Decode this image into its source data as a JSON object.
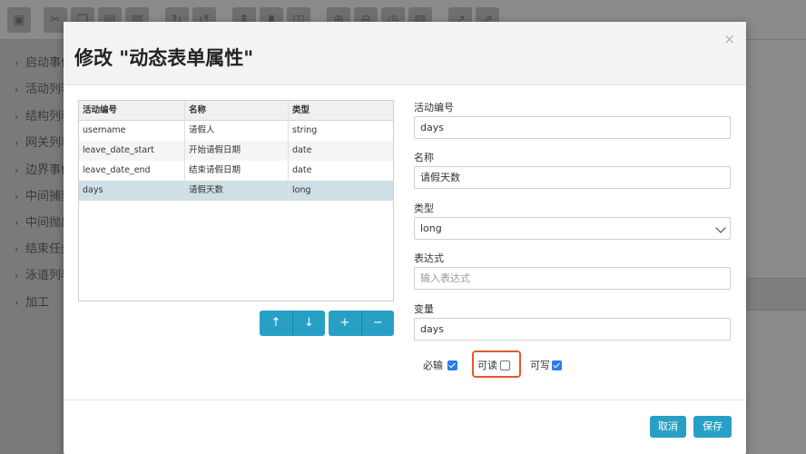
{
  "toolbar": {
    "icons": [
      "save-icon",
      "cut-icon",
      "copy-icon",
      "paste-icon",
      "delete-icon",
      "redo-icon",
      "undo-icon",
      "align-icon",
      "chart-icon",
      "node-icon",
      "zoom-in-icon",
      "zoom-out-icon",
      "zoom-reset-icon",
      "fit-icon",
      "bend-icon",
      "edge-icon"
    ]
  },
  "sidebar": {
    "items": [
      {
        "label": "启动事件"
      },
      {
        "label": "活动列表"
      },
      {
        "label": "结构列表"
      },
      {
        "label": "网关列表"
      },
      {
        "label": "边界事件"
      },
      {
        "label": "中间捕获"
      },
      {
        "label": "中间抛出"
      },
      {
        "label": "结束任务"
      },
      {
        "label": "泳道列表"
      },
      {
        "label": "加工"
      }
    ]
  },
  "modal": {
    "title": "修改 \"动态表单属性\"",
    "close_glyph": "×",
    "table": {
      "columns": [
        "活动编号",
        "名称",
        "类型"
      ],
      "rows": [
        {
          "id": "username",
          "name": "请假人",
          "type": "string"
        },
        {
          "id": "leave_date_start",
          "name": "开始请假日期",
          "type": "date"
        },
        {
          "id": "leave_date_end",
          "name": "结束请假日期",
          "type": "date"
        },
        {
          "id": "days",
          "name": "请假天数",
          "type": "long"
        }
      ]
    },
    "buttons": {
      "up": "↑",
      "down": "↓",
      "add": "+",
      "remove": "−"
    },
    "form": {
      "id_label": "活动编号",
      "id_value": "days",
      "name_label": "名称",
      "name_value": "请假天数",
      "type_label": "类型",
      "type_value": "long",
      "expression_label": "表达式",
      "expression_placeholder": "输入表达式",
      "variable_label": "变量",
      "variable_value": "days",
      "required_label": "必输",
      "required": true,
      "readable_label": "可读",
      "readable": false,
      "writable_label": "可写",
      "writable": true
    },
    "footer": {
      "cancel_label": "取消",
      "save_label": "保存"
    }
  },
  "colors": {
    "accent": "#28a0c6",
    "checkbox": "#2a7ee6",
    "highlight": "#e5572e"
  }
}
